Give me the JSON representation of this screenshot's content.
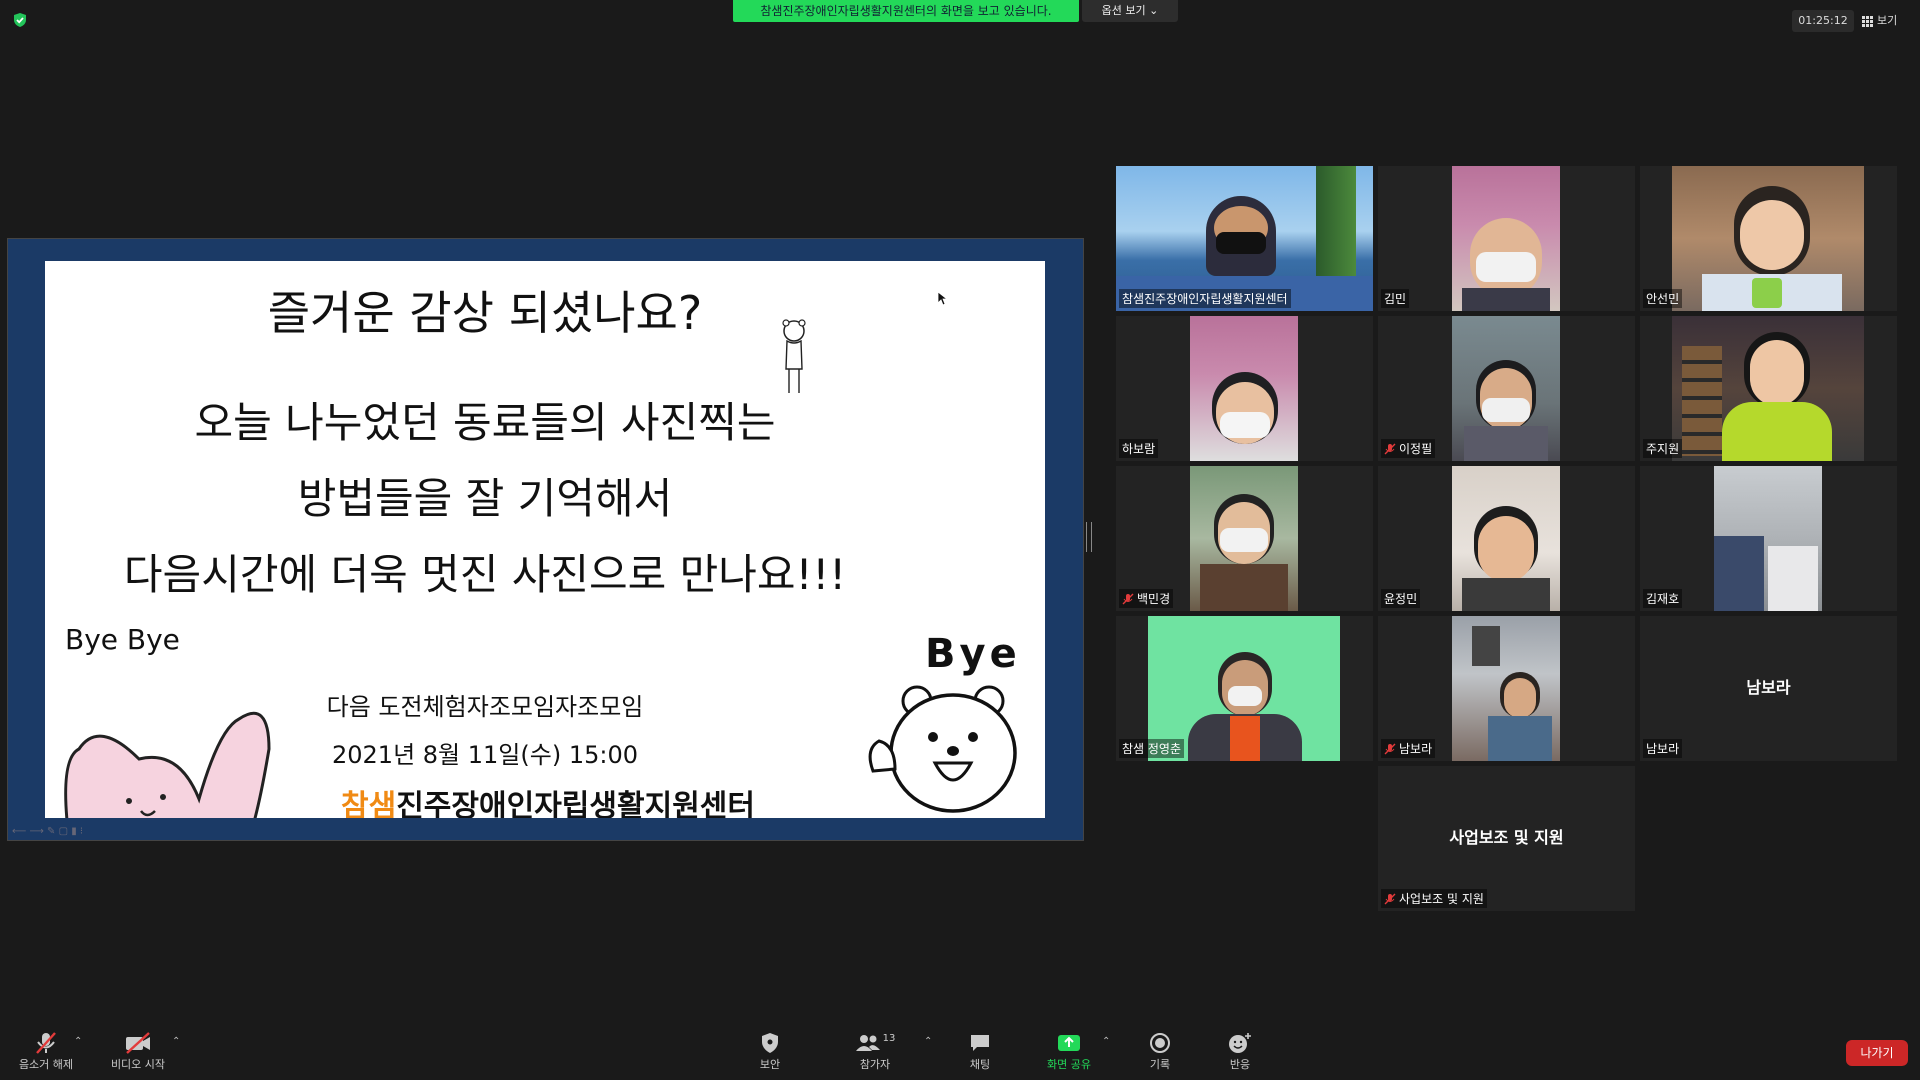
{
  "topbar": {
    "share_banner": "참샘진주장애인자립생활지원센터의 화면을 보고 있습니다.",
    "options_label": "옵션 보기 ⌄",
    "timer": "01:25:12",
    "view_label": "보기"
  },
  "slide": {
    "title": "즐거운 감상 되셨나요?",
    "line1": "오늘 나누었던 동료들의 사진찍는",
    "line2": "방법들을 잘 기억해서",
    "line3": "다음시간에 더욱 멋진 사진으로 만나요!!!",
    "bye_left": "Bye Bye",
    "next_meeting": "다음 도전체험자조모임자조모임",
    "date_time": "2021년 8월 11일(수) 15:00",
    "logo_brand": "참샘",
    "logo_rest": "진주장애인자립생활지원센터",
    "bye_right": "Bye"
  },
  "participants": [
    {
      "name": "참샘진주장애인자립생활지원센터",
      "muted": false,
      "video": true,
      "active": true
    },
    {
      "name": "김민",
      "muted": false,
      "video": true
    },
    {
      "name": "안선민",
      "muted": false,
      "video": true
    },
    {
      "name": "하보람",
      "muted": false,
      "video": true
    },
    {
      "name": "이정필",
      "muted": true,
      "video": true
    },
    {
      "name": "주지원",
      "muted": false,
      "video": true
    },
    {
      "name": "백민경",
      "muted": true,
      "video": true
    },
    {
      "name": "윤정민",
      "muted": false,
      "video": true
    },
    {
      "name": "김재호",
      "muted": false,
      "video": true
    },
    {
      "name": "참샘 정영춘",
      "muted": false,
      "video": true
    },
    {
      "name": "남보라",
      "muted": true,
      "video": true
    },
    {
      "name": "남보라",
      "muted": false,
      "video": false,
      "display": "남보라"
    },
    {
      "name": "사업보조 및 지원",
      "muted": true,
      "video": false,
      "display": "사업보조 및 지원"
    }
  ],
  "toolbar": {
    "mute": "음소거 해제",
    "video": "비디오 시작",
    "security": "보안",
    "participants": "참가자",
    "participants_count": "13",
    "chat": "채팅",
    "share": "화면 공유",
    "record": "기록",
    "reactions": "반응",
    "leave": "나가기"
  },
  "colors": {
    "banner": "#23d959",
    "active_speaker": "#e6e600",
    "leave": "#cc2727",
    "share_icon": "#23d959",
    "muted_icon": "#e23b3b"
  }
}
